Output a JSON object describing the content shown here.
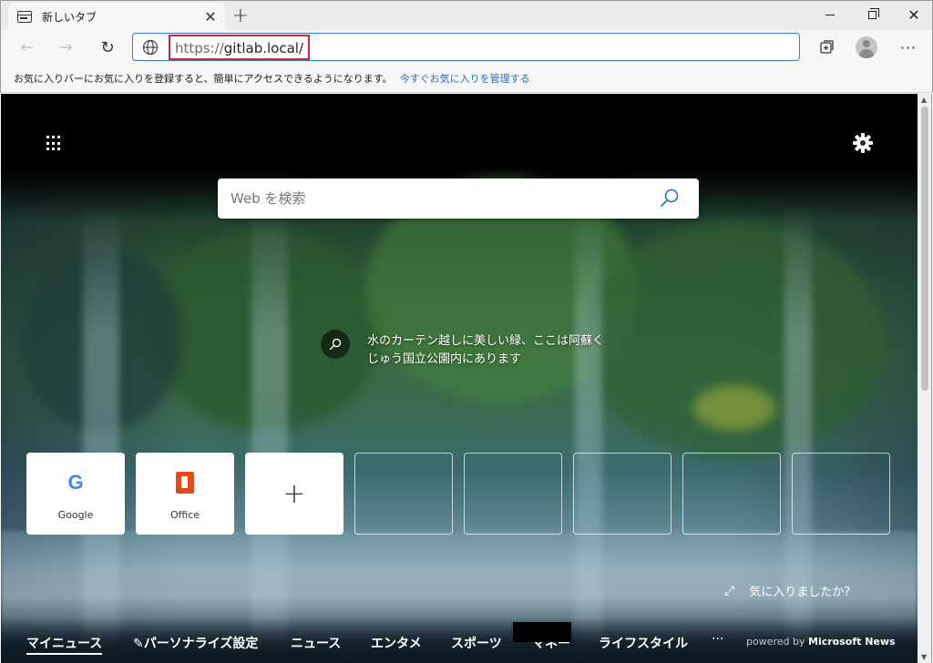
{
  "tab": {
    "title": "新しいタブ",
    "close_glyph": "✕",
    "new_tab_glyph": "+"
  },
  "window_controls": {
    "close_glyph": "✕"
  },
  "toolbar": {
    "back_glyph": "←",
    "forward_glyph": "→",
    "refresh_glyph": "↻",
    "url_protocol": "https://",
    "url_host": "gitlab.local/",
    "more_glyph": "···"
  },
  "favorites_bar": {
    "message": "お気に入りバーにお気に入りを登録すると、簡単にアクセスできるようになります。",
    "link": "今すぐお気に入りを管理する"
  },
  "search": {
    "placeholder": "Web を検索"
  },
  "photo": {
    "caption": "水のカーテン越しに美しい緑、ここは阿蘇くじゅう国立公園内にあります"
  },
  "tiles": [
    {
      "label": "Google",
      "logo": "G"
    },
    {
      "label": "Office",
      "logo": ""
    },
    {
      "label": "",
      "plus": "+"
    }
  ],
  "feedback": {
    "text": "気に入りましたか?",
    "icon_glyph": "⤢"
  },
  "news_nav": {
    "items": [
      "マイニュース",
      "パーソナライズ設定",
      "ニュース",
      "エンタメ",
      "スポーツ",
      "マネー",
      "ライフスタイル"
    ],
    "more": "···",
    "powered_by_prefix": "powered by",
    "powered_by_brand": "Microsoft News"
  },
  "colors": {
    "accent_blue": "#3a76d1",
    "highlight_red": "#c8283c",
    "link_blue": "#2a6bc4"
  }
}
